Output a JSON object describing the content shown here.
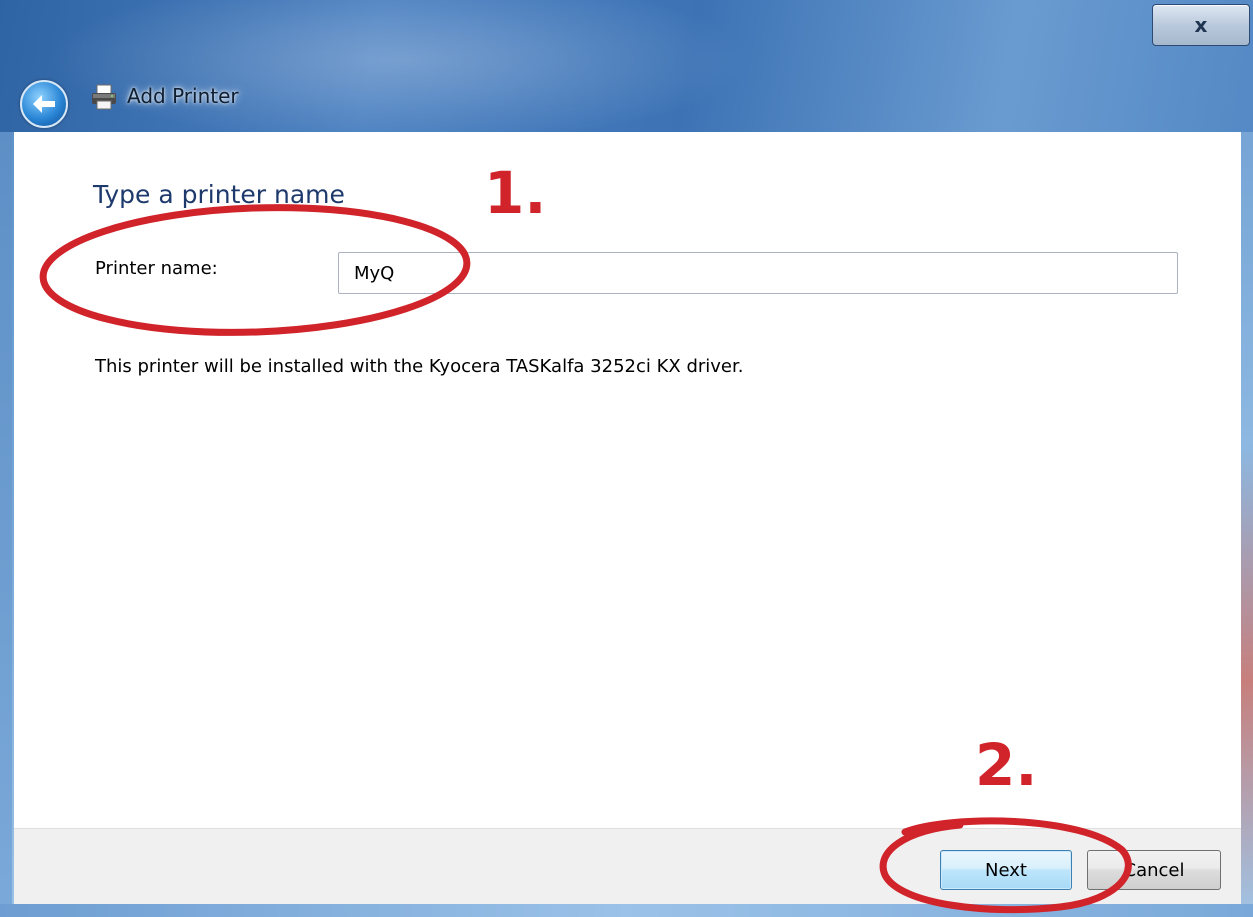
{
  "window": {
    "title": "Add Printer",
    "close_label": "x"
  },
  "page": {
    "heading": "Type a printer name",
    "printer_name_label": "Printer name:",
    "printer_name_value": "MyQ",
    "driver_message": "This printer will be installed with the Kyocera TASKalfa 3252ci KX driver."
  },
  "footer": {
    "next_label": "Next",
    "cancel_label": "Cancel"
  },
  "annotations": {
    "step1_label": "1.",
    "step2_label": "2.",
    "color": "#d1232a"
  }
}
